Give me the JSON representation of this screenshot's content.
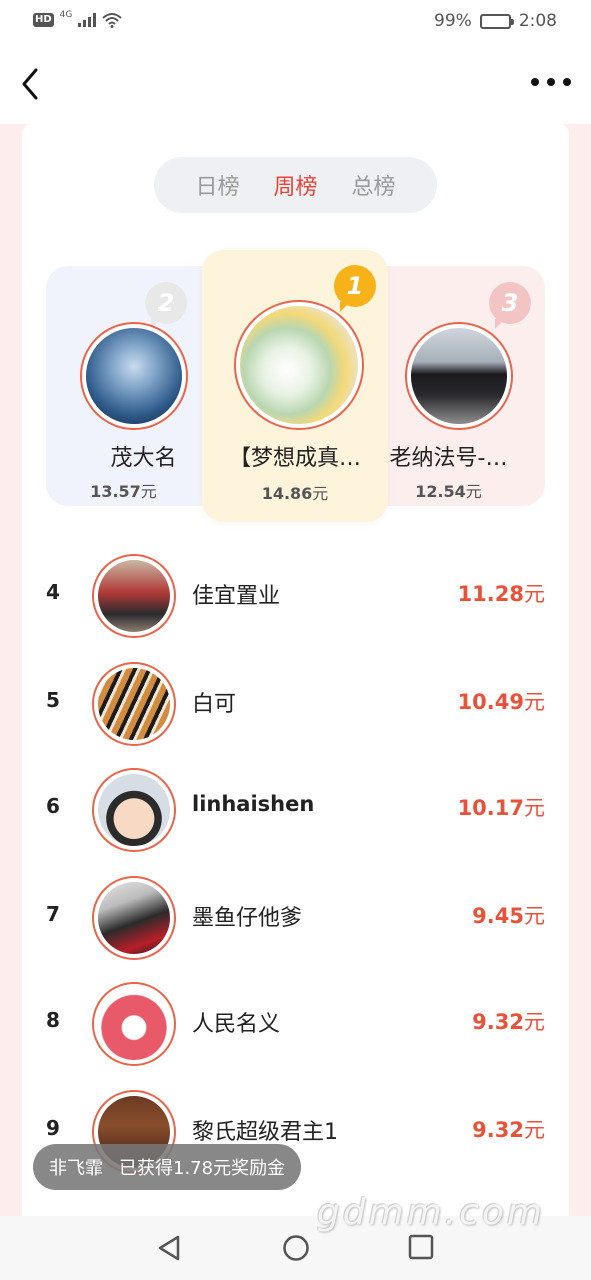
{
  "status_bar": {
    "hd": "HD",
    "network": "4G",
    "battery_percent": "99%",
    "time": "2:08"
  },
  "nav": {
    "back_icon": "chevron-left-icon",
    "more_icon": "more-horizontal-icon"
  },
  "tabs": [
    {
      "label": "日榜",
      "active": false
    },
    {
      "label": "周榜",
      "active": true
    },
    {
      "label": "总榜",
      "active": false
    }
  ],
  "podium": {
    "first": {
      "rank": "1",
      "name": "【梦想成真…",
      "amount": "14.86",
      "unit": "元",
      "avatar": "drink-photo"
    },
    "second": {
      "rank": "2",
      "name": "茂大名",
      "amount": "13.57",
      "unit": "元",
      "avatar": "earth-photo"
    },
    "third": {
      "rank": "3",
      "name": "老纳法号-…",
      "amount": "12.54",
      "unit": "元",
      "avatar": "car-photo"
    }
  },
  "list": [
    {
      "rank": "4",
      "name": "佳宜置业",
      "amount": "11.28",
      "unit": "元"
    },
    {
      "rank": "5",
      "name": "白可",
      "amount": "10.49",
      "unit": "元"
    },
    {
      "rank": "6",
      "name": "linhaishen",
      "amount": "10.17",
      "unit": "元"
    },
    {
      "rank": "7",
      "name": "墨鱼仔他爹",
      "amount": "9.45",
      "unit": "元"
    },
    {
      "rank": "8",
      "name": "人民名义",
      "amount": "9.32",
      "unit": "元"
    },
    {
      "rank": "9",
      "name": "黎氏超级君主1",
      "amount": "9.32",
      "unit": "元"
    }
  ],
  "toast": {
    "user": "非飞霏",
    "message": "已获得1.78元奖励金"
  },
  "watermark": "gdmm.com",
  "colors": {
    "accent": "#e8443a",
    "amount": "#e8523a",
    "gold": "#f7b21a"
  }
}
